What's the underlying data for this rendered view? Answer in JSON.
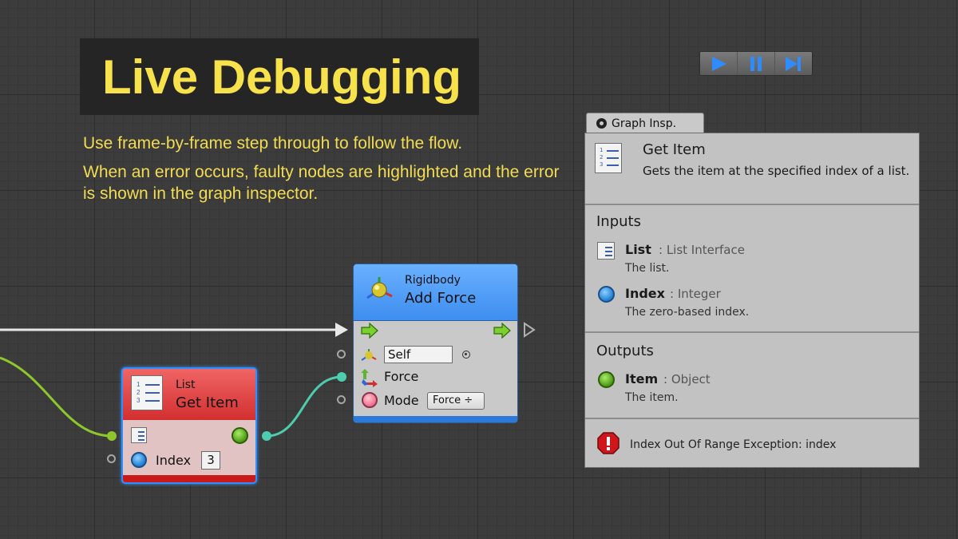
{
  "heading": {
    "title": "Live Debugging",
    "line1": "Use frame-by-frame step through to follow the flow.",
    "line2": "When an error occurs, faulty nodes are highlighted and the error is shown in the graph inspector."
  },
  "debug_toolbar": {
    "buttons": [
      "play-icon",
      "pause-icon",
      "step-icon"
    ],
    "accent_color": "#2f8cff"
  },
  "inspector": {
    "tab_label": "Graph Insp.",
    "node_title": "Get Item",
    "node_description": "Gets the item at the specified index of a list.",
    "inputs_heading": "Inputs",
    "inputs": [
      {
        "name": "List",
        "type": ": List Interface",
        "description": "The list."
      },
      {
        "name": "Index",
        "type": ": Integer",
        "description": "The zero-based index."
      }
    ],
    "outputs_heading": "Outputs",
    "outputs": [
      {
        "name": "Item",
        "type": ": Object",
        "description": "The item."
      }
    ],
    "error_message": "Index Out Of Range Exception: index"
  },
  "nodes": {
    "add_force": {
      "category": "Rigidbody",
      "title": "Add Force",
      "target_value": "Self",
      "force_label": "Force",
      "mode_label": "Mode",
      "mode_value": "Force ÷",
      "header_color": "#4a9bf5"
    },
    "get_item": {
      "category": "List",
      "title": "Get Item",
      "index_label": "Index",
      "index_value": "3",
      "header_color": "#e04444"
    }
  },
  "colors": {
    "title_text": "#f7e24c",
    "wire_green": "#8dc72b",
    "wire_teal": "#4ecdae",
    "error_red": "#d0161d"
  }
}
